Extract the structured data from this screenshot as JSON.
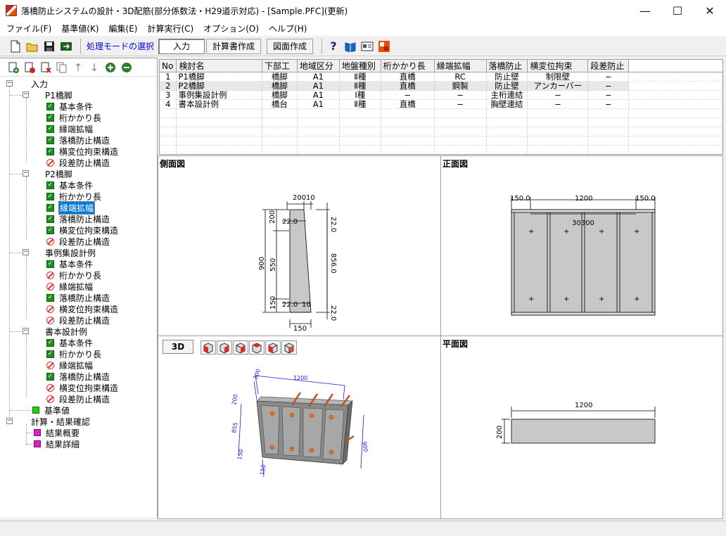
{
  "window": {
    "title": "落橋防止システムの設計・3D配筋(部分係数法・H29道示対応) - [Sample.PFC](更新)",
    "minimize": "—",
    "maximize": "☐",
    "close": "✕"
  },
  "menu": [
    "ファイル(F)",
    "基準値(K)",
    "編集(E)",
    "計算実行(C)",
    "オプション(O)",
    "ヘルプ(H)"
  ],
  "toolbar": {
    "mode_label": "処理モードの選択",
    "buttons": [
      "入力",
      "計算書作成",
      "図面作成"
    ]
  },
  "tree": {
    "root": "入力",
    "groups": [
      {
        "name": "P1橋脚",
        "items": [
          {
            "label": "基本条件",
            "state": "on"
          },
          {
            "label": "桁かかり長",
            "state": "on"
          },
          {
            "label": "縁端拡幅",
            "state": "on"
          },
          {
            "label": "落橋防止構造",
            "state": "on"
          },
          {
            "label": "横変位拘束構造",
            "state": "on"
          },
          {
            "label": "段差防止構造",
            "state": "off"
          }
        ]
      },
      {
        "name": "P2橋脚",
        "items": [
          {
            "label": "基本条件",
            "state": "on"
          },
          {
            "label": "桁かかり長",
            "state": "on"
          },
          {
            "label": "縁端拡幅",
            "state": "on"
          },
          {
            "label": "落橋防止構造",
            "state": "on"
          },
          {
            "label": "横変位拘束構造",
            "state": "on"
          },
          {
            "label": "段差防止構造",
            "state": "off"
          }
        ]
      },
      {
        "name": "事例集設計例",
        "items": [
          {
            "label": "基本条件",
            "state": "on"
          },
          {
            "label": "桁かかり長",
            "state": "off"
          },
          {
            "label": "縁端拡幅",
            "state": "off"
          },
          {
            "label": "落橋防止構造",
            "state": "on"
          },
          {
            "label": "横変位拘束構造",
            "state": "off"
          },
          {
            "label": "段差防止構造",
            "state": "off"
          }
        ]
      },
      {
        "name": "書本設計例",
        "items": [
          {
            "label": "基本条件",
            "state": "on"
          },
          {
            "label": "桁かかり長",
            "state": "on"
          },
          {
            "label": "縁端拡幅",
            "state": "off"
          },
          {
            "label": "落橋防止構造",
            "state": "on"
          },
          {
            "label": "横変位拘束構造",
            "state": "off"
          },
          {
            "label": "段差防止構造",
            "state": "off"
          }
        ]
      }
    ],
    "standard": "基準値",
    "calc_root": "計算・結果確認",
    "calc_items": [
      "結果概要",
      "結果詳細"
    ]
  },
  "table": {
    "headers": [
      "No",
      "検討名",
      "下部工",
      "地域区分",
      "地盤種別",
      "桁かかり長",
      "縁端拡幅",
      "落橋防止",
      "横変位拘束",
      "段差防止"
    ],
    "rows": [
      [
        "1",
        "P1橋脚",
        "橋脚",
        "A1",
        "Ⅱ種",
        "直橋",
        "RC",
        "防止壁",
        "制限壁",
        "−"
      ],
      [
        "2",
        "P2橋脚",
        "橋脚",
        "A1",
        "Ⅱ種",
        "直橋",
        "鋼製",
        "防止壁",
        "アンカーバー",
        "−"
      ],
      [
        "3",
        "事例集設計例",
        "橋脚",
        "A1",
        "Ⅰ種",
        "−",
        "−",
        "主桁連結",
        "−",
        "−"
      ],
      [
        "4",
        "書本設計例",
        "橋台",
        "A1",
        "Ⅱ種",
        "直橋",
        "−",
        "胸壁連結",
        "−",
        "−"
      ]
    ]
  },
  "panes": {
    "side_title": "側面図",
    "front_title": "正面図",
    "view3d_button": "3D",
    "plan_title": "平面図"
  },
  "drawing": {
    "side": {
      "top_w": "200",
      "top_r": "10",
      "d22a": "22.0",
      "d200": "200",
      "d22b": "22.0",
      "d900": "900",
      "d550": "550",
      "d856": "856.0",
      "d150": "150",
      "d22c": "22.0",
      "d10": "10",
      "d22d": "22.0",
      "bottom": "150"
    },
    "front": {
      "left": "150.0",
      "mid": "1200",
      "right": "150.0",
      "inner": "30300"
    },
    "view3d": {
      "w": "1200",
      "h": "900",
      "a": "300",
      "b": "200",
      "c": "855",
      "d": "150",
      "e": "150"
    },
    "plan": {
      "w": "1200",
      "h": "200"
    }
  }
}
